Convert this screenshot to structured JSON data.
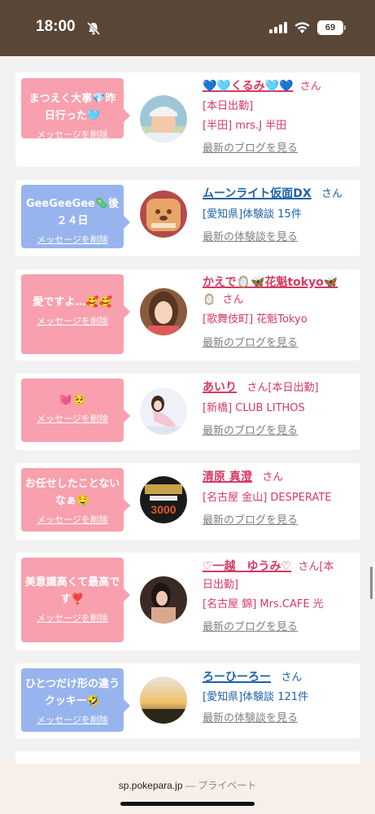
{
  "status_bar": {
    "time": "18:00",
    "battery": "69"
  },
  "cards": [
    {
      "bubble": {
        "text": "まつえく大事💎昨日行った🩵",
        "delete": "メッセージを削除",
        "color": "pink"
      },
      "name": "💙🩵くるみ🩵💙",
      "name_color": "pink",
      "san": "さん",
      "line1": "[本日出勤]",
      "line2": "[半田] mrs.J 半田",
      "link": "最新のブログを見る"
    },
    {
      "bubble": {
        "text": "GeeGeeGee🦠後２４日",
        "delete": "メッセージを削除",
        "color": "blue"
      },
      "name": "ムーンライト仮面DX",
      "name_color": "blue",
      "san": "さん",
      "line1": "[愛知県]体験談 15件",
      "link": "最新の体験談を見る"
    },
    {
      "bubble": {
        "text": "愛ですよ…🥰🥰",
        "delete": "メッセージを削除",
        "color": "pink"
      },
      "name": "かえで🪞🦋花魁tokyo🦋",
      "name_color": "pink",
      "name_tail": "🪞",
      "san": "さん",
      "line1": "[歌舞伎町] 花魁Tokyo",
      "link": "最新のブログを見る"
    },
    {
      "bubble": {
        "text": "💓🥺",
        "delete": "メッセージを削除",
        "color": "pink"
      },
      "name": "あいり",
      "name_color": "pink",
      "san": "さん[本日出勤]",
      "line1": "[新橋] CLUB LITHOS",
      "link": "最新のブログを見る"
    },
    {
      "bubble": {
        "text": "お任せしたことないなぁ🤤",
        "delete": "メッセージを削除",
        "color": "pink"
      },
      "name": "清原 真澄",
      "name_color": "pink",
      "san": "さん",
      "line1": "[名古屋 金山] DESPERATE",
      "link": "最新のブログを見る",
      "avatar_text": "3000"
    },
    {
      "bubble": {
        "text": "美意識高くて最高です❣️",
        "delete": "メッセージを削除",
        "color": "pink"
      },
      "name": "♡一越　ゆうみ♡",
      "name_color": "pink",
      "san": "さん[本",
      "line1": "日出勤]",
      "line2": "[名古屋 錦] Mrs.CAFE 光",
      "link": "最新のブログを見る"
    },
    {
      "bubble": {
        "text": "ひとつだけ形の違うクッキー🤣",
        "delete": "メッセージを削除",
        "color": "blue"
      },
      "name": "ろーひーろー",
      "name_color": "blue",
      "san": "さん",
      "line1": "[愛知県]体験談 121件",
      "link": "最新の体験談を見る"
    }
  ],
  "bottom": {
    "url": "sp.pokepara.jp",
    "private": " — プライベート"
  },
  "colors": {
    "status_bg": "#5a4636",
    "pink_bubble": "#f8a0ad",
    "blue_bubble": "#98b4ee",
    "pink_text": "#d63a62",
    "blue_text": "#1e62a8"
  }
}
